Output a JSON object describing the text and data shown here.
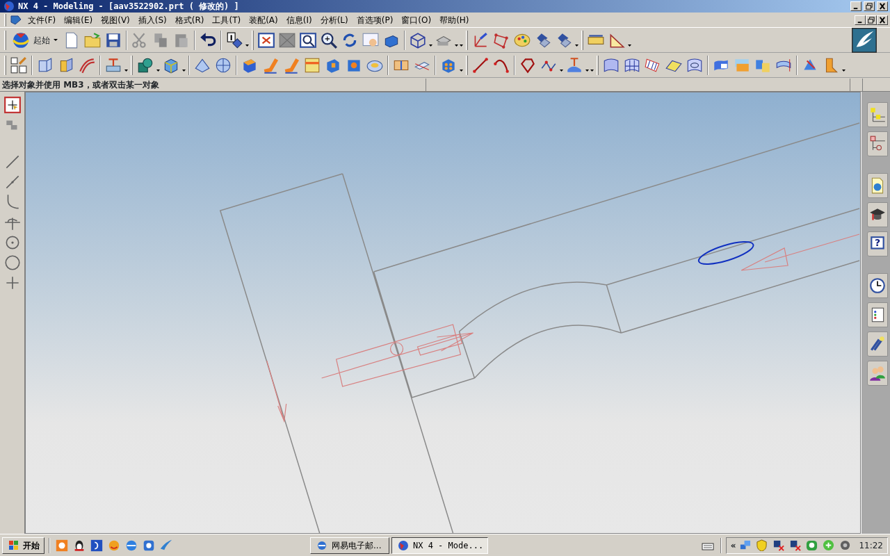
{
  "window": {
    "title": "NX 4 - Modeling - [aav3522902.prt ( 修改的) ]"
  },
  "menus": [
    {
      "label": "文件(F)"
    },
    {
      "label": "编辑(E)"
    },
    {
      "label": "视图(V)"
    },
    {
      "label": "插入(S)"
    },
    {
      "label": "格式(R)"
    },
    {
      "label": "工具(T)"
    },
    {
      "label": "装配(A)"
    },
    {
      "label": "信息(I)"
    },
    {
      "label": "分析(L)"
    },
    {
      "label": "首选项(P)"
    },
    {
      "label": "窗口(O)"
    },
    {
      "label": "帮助(H)"
    }
  ],
  "toolbar": {
    "start_label": "起始"
  },
  "resource_bar": {
    "help_mark": "?"
  },
  "prompt": "选择对象并使用 MB3，或者双击某一对象",
  "taskbar": {
    "start": "开始",
    "tasks": [
      {
        "label": "网易电子邮...",
        "selected": false
      },
      {
        "label": "NX 4 - Mode...",
        "selected": true
      }
    ],
    "tray_toggle": "«",
    "clock": "11:22"
  }
}
